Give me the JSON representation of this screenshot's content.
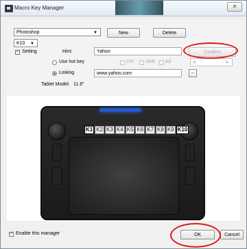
{
  "window": {
    "title": "Macro Key Manager",
    "close_label": "✕"
  },
  "header": {
    "application_select": "Photoshop",
    "new_label": "New",
    "delete_label": "Delete",
    "key_select": "K10"
  },
  "settings": {
    "setting_label": "Setting",
    "setting_checked": true,
    "hint_label": "Hint:",
    "hint_value": "Yahoo",
    "confirm_label": "Confirm",
    "use_hot_key_label": "Use hot key",
    "ctrl_label": "Ctrl",
    "shift_label": "Shift",
    "alt_label": "Alt",
    "hotkey_select": "A",
    "linking_label": "Linking",
    "linking_value": "www.yahoo.com",
    "browse_label": "...",
    "tablet_model_label": "Tablet Model:",
    "tablet_model_value": "11.6\""
  },
  "tablet": {
    "keys": [
      {
        "label": "K1",
        "active": true
      },
      {
        "label": "K2",
        "active": false
      },
      {
        "label": "K3",
        "active": false
      },
      {
        "label": "K4",
        "active": false
      },
      {
        "label": "K5",
        "active": false
      },
      {
        "label": "K6",
        "active": false
      },
      {
        "label": "K7",
        "active": false
      },
      {
        "label": "K8",
        "active": false
      },
      {
        "label": "K9",
        "active": false
      },
      {
        "label": "K10",
        "active": true
      }
    ]
  },
  "footer": {
    "enable_label": "Enable this manager",
    "enable_checked": true,
    "ok_label": "OK",
    "cancel_label": "Cancel"
  },
  "colors": {
    "annotation": "#e01515",
    "tablet_led": "#1d5de0"
  }
}
